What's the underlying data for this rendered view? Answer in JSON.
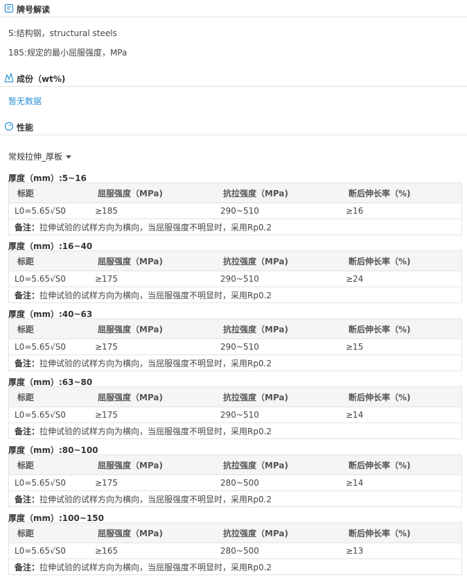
{
  "sections": {
    "grade": {
      "title": "牌号解读",
      "lines": [
        "S:结构钢，structural steels",
        "185:规定的最小屈服强度，MPa"
      ]
    },
    "composition": {
      "title": "成份（wt%)",
      "empty": "暂无数据"
    },
    "performance": {
      "title": "性能"
    }
  },
  "dropdown": {
    "selected": "常规拉伸_厚板"
  },
  "table_headers": [
    "标距",
    "屈服强度（MPa)",
    "抗拉强度（MPa)",
    "断后伸长率（%)"
  ],
  "note_label": "备注：",
  "note_text": "拉伸试验的试样方向为横向，当屈服强度不明显时，采用Rp0.2",
  "blocks": [
    {
      "title": "厚度（mm）:5~16",
      "row": [
        "L0=5.65√S0",
        "≥185",
        "290~510",
        "≥16"
      ]
    },
    {
      "title": "厚度（mm）:16~40",
      "row": [
        "L0=5.65√S0",
        "≥175",
        "290~510",
        "≥24"
      ]
    },
    {
      "title": "厚度（mm）:40~63",
      "row": [
        "L0=5.65√S0",
        "≥175",
        "290~510",
        "≥15"
      ]
    },
    {
      "title": "厚度（mm）:63~80",
      "row": [
        "L0=5.65√S0",
        "≥175",
        "290~510",
        "≥14"
      ]
    },
    {
      "title": "厚度（mm）:80~100",
      "row": [
        "L0=5.65√S0",
        "≥175",
        "280~500",
        "≥14"
      ]
    },
    {
      "title": "厚度（mm）:100~150",
      "row": [
        "L0=5.65√S0",
        "≥165",
        "280~500",
        "≥13"
      ]
    }
  ],
  "colors": {
    "accent": "#2b8fd6",
    "header_bg": "#f5f5f5",
    "border": "#e3e3e3"
  }
}
